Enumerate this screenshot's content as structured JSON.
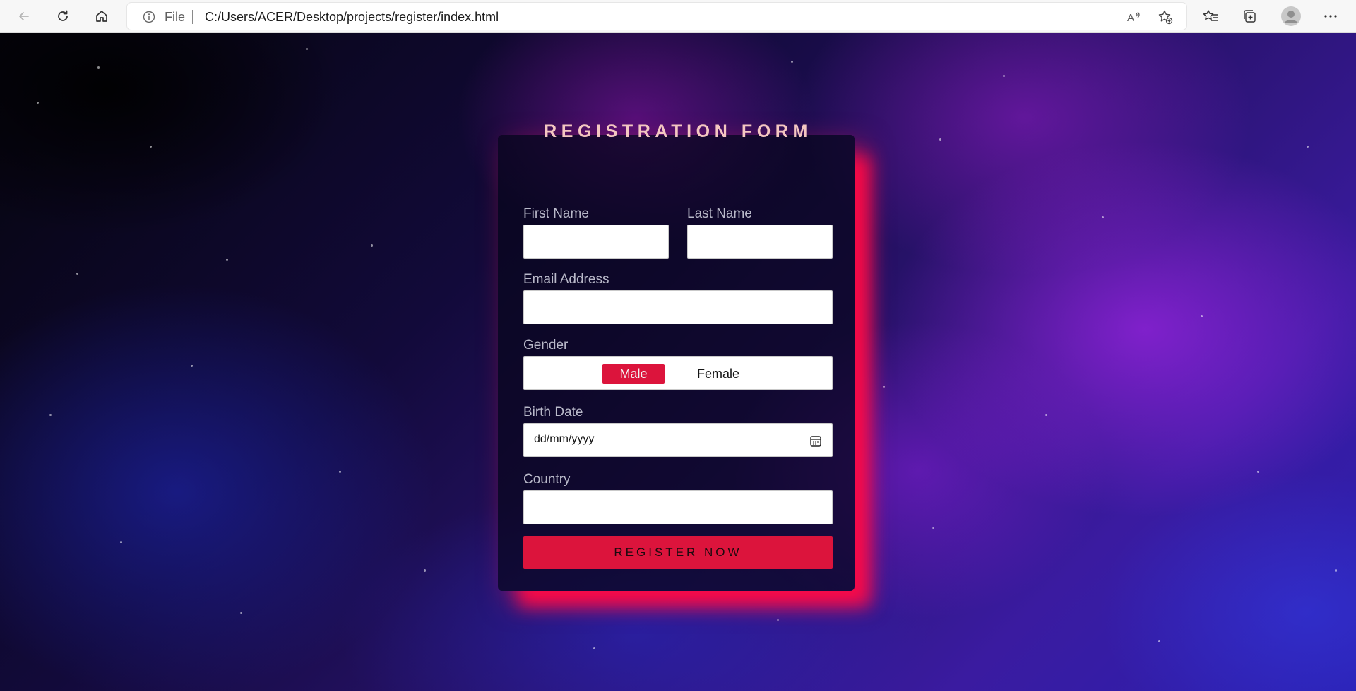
{
  "browser": {
    "address_prefix": "File",
    "url": "C:/Users/ACER/Desktop/projects/register/index.html",
    "buttons": [
      "back-icon",
      "refresh-icon",
      "home-icon",
      "read-aloud-icon",
      "add-favorite-icon",
      "favorites-icon",
      "collections-icon",
      "profile-icon",
      "more-icon"
    ]
  },
  "form": {
    "title": "REGISTRATION FORM",
    "first_name_label": "First Name",
    "first_name_value": "",
    "last_name_label": "Last Name",
    "last_name_value": "",
    "email_label": "Email Address",
    "email_value": "",
    "gender_label": "Gender",
    "gender_options": [
      "Male",
      "Female"
    ],
    "gender_selected": "Male",
    "birth_date_label": "Birth Date",
    "birth_date_placeholder": "dd/mm/yyyy",
    "country_label": "Country",
    "country_value": "",
    "submit_label": "REGISTER NOW"
  },
  "colors": {
    "accent": "#dc143c",
    "title": "#f4c7c1",
    "label": "#b9b9c9"
  }
}
